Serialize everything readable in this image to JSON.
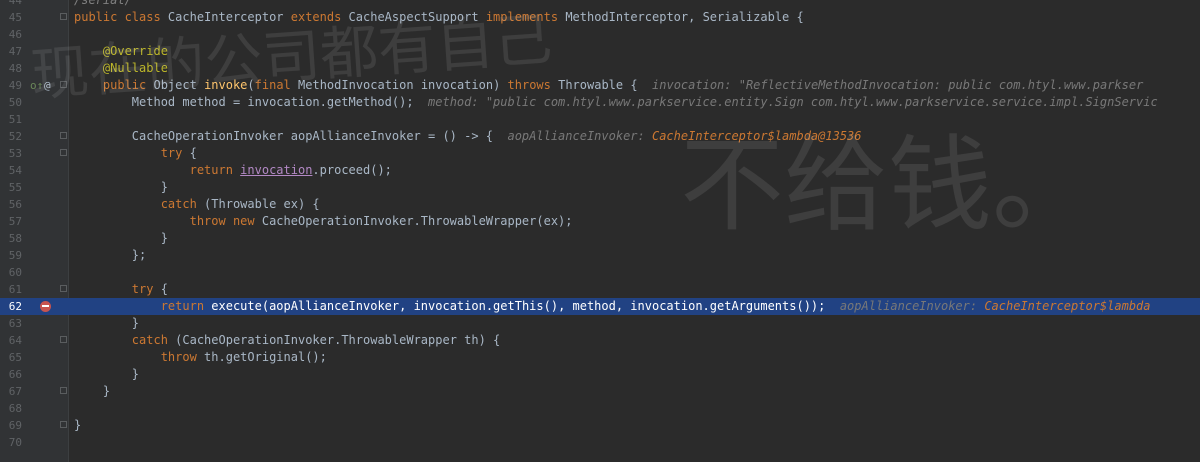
{
  "editor": {
    "lines": [
      {
        "n": "44",
        "seg": [
          {
            "t": "/serial/",
            "c": "cm"
          }
        ]
      },
      {
        "n": "45",
        "seg": [
          {
            "t": "public class ",
            "c": "kw"
          },
          {
            "t": "CacheInterceptor ",
            "c": ""
          },
          {
            "t": "extends ",
            "c": "kw"
          },
          {
            "t": "CacheAspectSupport ",
            "c": ""
          },
          {
            "t": "implements ",
            "c": "kw"
          },
          {
            "t": "MethodInterceptor, Serializable {",
            "c": ""
          }
        ]
      },
      {
        "n": "46",
        "seg": []
      },
      {
        "n": "47",
        "seg": [
          {
            "t": "    @Override",
            "c": "an"
          }
        ]
      },
      {
        "n": "48",
        "seg": [
          {
            "t": "    @Nullable",
            "c": "an"
          }
        ]
      },
      {
        "n": "49",
        "seg": [
          {
            "t": "    public ",
            "c": "kw"
          },
          {
            "t": "Object ",
            "c": ""
          },
          {
            "t": "invoke",
            "c": "fn"
          },
          {
            "t": "(",
            "c": ""
          },
          {
            "t": "final ",
            "c": "kw"
          },
          {
            "t": "MethodInvocation invocation) ",
            "c": ""
          },
          {
            "t": "throws ",
            "c": "kw"
          },
          {
            "t": "Throwable {  ",
            "c": ""
          },
          {
            "t": "invocation: ",
            "c": "hint"
          },
          {
            "t": "\"ReflectiveMethodInvocation: public com.htyl.www.parkser",
            "c": "hint"
          }
        ]
      },
      {
        "n": "50",
        "seg": [
          {
            "t": "        Method method = invocation.getMethod();  ",
            "c": ""
          },
          {
            "t": "method: ",
            "c": "hint"
          },
          {
            "t": "\"public com.htyl.www.parkservice.entity.Sign com.htyl.www.parkservice.service.impl.SignServic",
            "c": "hint"
          }
        ]
      },
      {
        "n": "51",
        "seg": []
      },
      {
        "n": "52",
        "seg": [
          {
            "t": "        CacheOperationInvoker aopAllianceInvoker = () -> {  ",
            "c": ""
          },
          {
            "t": "aopAllianceInvoker: ",
            "c": "hint"
          },
          {
            "t": "CacheInterceptor$lambda@13536",
            "c": "hintval"
          }
        ]
      },
      {
        "n": "53",
        "seg": [
          {
            "t": "            try ",
            "c": "kw"
          },
          {
            "t": "{",
            "c": ""
          }
        ]
      },
      {
        "n": "54",
        "seg": [
          {
            "t": "                return ",
            "c": "kw"
          },
          {
            "t": "invocation",
            "c": "ul"
          },
          {
            "t": ".proceed();",
            "c": ""
          }
        ]
      },
      {
        "n": "55",
        "seg": [
          {
            "t": "            }",
            "c": ""
          }
        ]
      },
      {
        "n": "56",
        "seg": [
          {
            "t": "            catch ",
            "c": "kw"
          },
          {
            "t": "(Throwable ex) {",
            "c": ""
          }
        ]
      },
      {
        "n": "57",
        "seg": [
          {
            "t": "                throw new ",
            "c": "kw"
          },
          {
            "t": "CacheOperationInvoker.ThrowableWrapper(ex);",
            "c": ""
          }
        ]
      },
      {
        "n": "58",
        "seg": [
          {
            "t": "            }",
            "c": ""
          }
        ]
      },
      {
        "n": "59",
        "seg": [
          {
            "t": "        };",
            "c": ""
          }
        ]
      },
      {
        "n": "60",
        "seg": []
      },
      {
        "n": "61",
        "seg": [
          {
            "t": "        try ",
            "c": "kw"
          },
          {
            "t": "{",
            "c": ""
          }
        ]
      },
      {
        "n": "62",
        "current": true,
        "seg": [
          {
            "t": "            return ",
            "c": "kw"
          },
          {
            "t": "execute(aopAllianceInvoker, invocation.getThis(), method, invocation.getArguments());  ",
            "c": ""
          },
          {
            "t": "aopAllianceInvoker: ",
            "c": "hint"
          },
          {
            "t": "CacheInterceptor$lambda",
            "c": "hintval"
          }
        ]
      },
      {
        "n": "63",
        "seg": [
          {
            "t": "        }",
            "c": ""
          }
        ]
      },
      {
        "n": "64",
        "seg": [
          {
            "t": "        catch ",
            "c": "kw"
          },
          {
            "t": "(CacheOperationInvoker.ThrowableWrapper th) {",
            "c": ""
          }
        ]
      },
      {
        "n": "65",
        "seg": [
          {
            "t": "            throw ",
            "c": "kw"
          },
          {
            "t": "th.getOriginal();",
            "c": ""
          }
        ]
      },
      {
        "n": "66",
        "seg": [
          {
            "t": "        }",
            "c": ""
          }
        ]
      },
      {
        "n": "67",
        "seg": [
          {
            "t": "    }",
            "c": ""
          }
        ]
      },
      {
        "n": "68",
        "seg": []
      },
      {
        "n": "69",
        "seg": [
          {
            "t": "}",
            "c": ""
          }
        ]
      },
      {
        "n": "70",
        "seg": []
      }
    ]
  },
  "watermark": {
    "top_text": "现在的公司都有自己",
    "bottom_text": "不给钱。"
  }
}
